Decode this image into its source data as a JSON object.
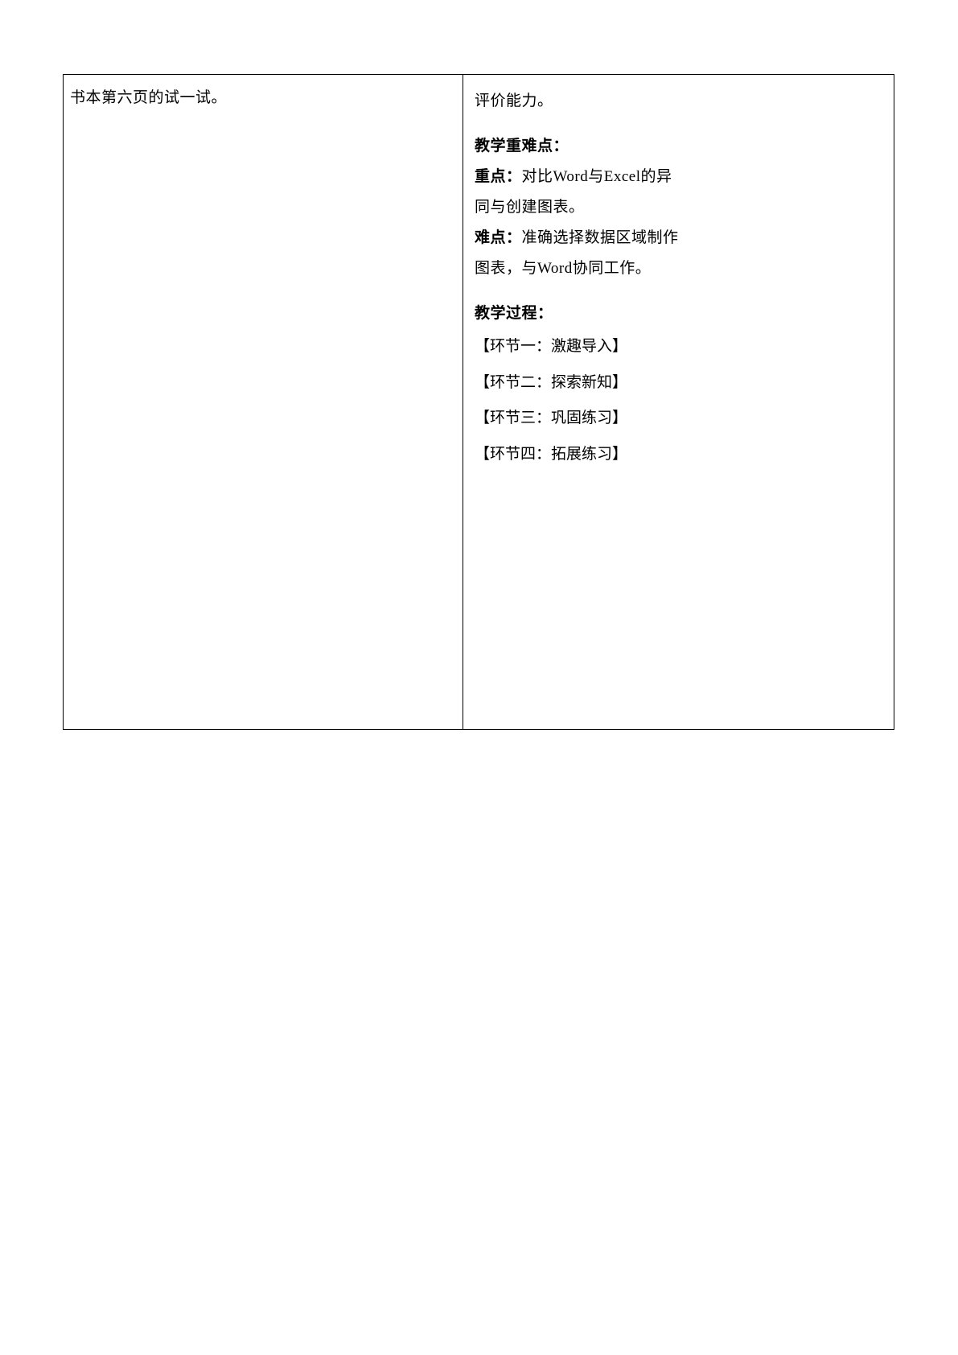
{
  "leftColumn": {
    "line1": "书本第六页的试一试。"
  },
  "rightColumn": {
    "evalAbility": "评价能力。",
    "keyDiffHeader": "教学重难点：",
    "keyPointLabel": "重点：",
    "keyPointText1": "对比Word与Excel的异",
    "keyPointText2": "同与创建图表。",
    "diffPointLabel": "难点：",
    "diffPointText1": "准确选择数据区域制作",
    "diffPointText2": "图表，与Word协同工作。",
    "processHeader": "教学过程：",
    "process1": "【环节一：激趣导入】",
    "process2": "【环节二：探索新知】",
    "process3": "【环节三：巩固练习】",
    "process4": "【环节四：拓展练习】"
  }
}
